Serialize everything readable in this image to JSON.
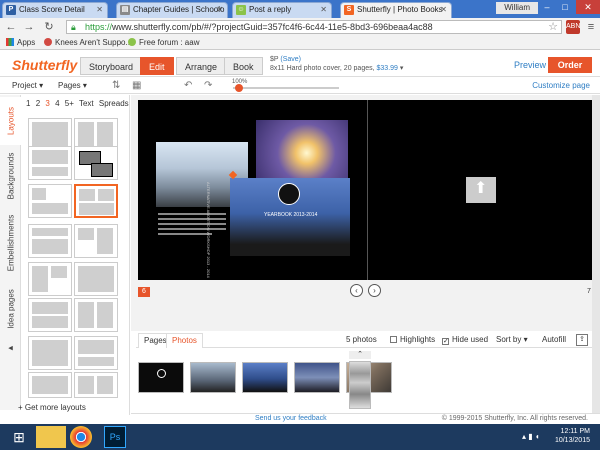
{
  "browser": {
    "tabs": [
      {
        "title": "Class Score Detail",
        "icon_letter": "P",
        "icon_color": "#2e5fa3"
      },
      {
        "title": "Chapter Guides | Schoolo",
        "icon_letter": "▤",
        "icon_color": "#8a8a8a"
      },
      {
        "title": "Post a reply",
        "icon_letter": "☺",
        "icon_color": "#8bc34a"
      },
      {
        "title": "Shutterfly | Photo Books",
        "icon_letter": "S",
        "icon_color": "#f26522"
      }
    ],
    "user": "William",
    "window_minimize": "–",
    "window_maximize": "□",
    "window_close": "✕",
    "url_scheme": "https://",
    "url_rest": "www.shutterfly.com/pb/#/?projectGuid=357fc4f6-6c44-11e5-8bd3-696beaa4ac88",
    "ext_badge": "ABN",
    "bookmarks": [
      {
        "label": "Apps",
        "icon": "apps-icon"
      },
      {
        "label": "Knees Aren't Suppo...",
        "icon": "bookmark-icon"
      },
      {
        "label": "Free forum : aaw",
        "icon": "forum-icon"
      }
    ]
  },
  "app": {
    "logo": "Shutterfly",
    "tabs": [
      "Storyboard",
      "Edit",
      "Arrange",
      "Book"
    ],
    "active_tab": "Edit",
    "price_line": "$P (Save)",
    "save_label": "(Save)",
    "price_prefix": "$P",
    "product_line": "8x11 Hard photo cover, 20 pages,",
    "product_price": "$33.99",
    "preview": "Preview",
    "order": "Order",
    "project_menu": "Project",
    "pages_menu": "Pages",
    "zoom_label": "100%",
    "zoom_fraction": 0.02,
    "customize_page": "Customize page"
  },
  "left_tabs": [
    "Layouts",
    "Backgrounds",
    "Embellishments",
    "Idea pages"
  ],
  "layout_filters": [
    "1",
    "2",
    "3",
    "4",
    "5+",
    "Text",
    "Spreads"
  ],
  "layout_filter_active": "3",
  "get_more_layouts": "Get more layouts",
  "canvas": {
    "left_page_number": "6",
    "right_page_number": "7",
    "prev": "‹",
    "next": "›",
    "cover_title": "YEARBOOK 2013-2014",
    "cover_subtitle": "ALTERNATIVE ABORTION WORKSHOP 2013 - 2014"
  },
  "tray": {
    "tabs": [
      "Pages",
      "Photos"
    ],
    "active_tab": "Photos",
    "photo_count": "5 photos",
    "highlights": "Highlights",
    "hide_used": "Hide used",
    "sort_by": "Sort by",
    "autofill": "Autofill"
  },
  "footer": {
    "feedback": "Send us your feedback",
    "copyright": "© 1999-2015 Shutterfly, Inc. All rights reserved."
  },
  "taskbar": {
    "time": "12:11 PM",
    "date": "10/13/2015"
  }
}
